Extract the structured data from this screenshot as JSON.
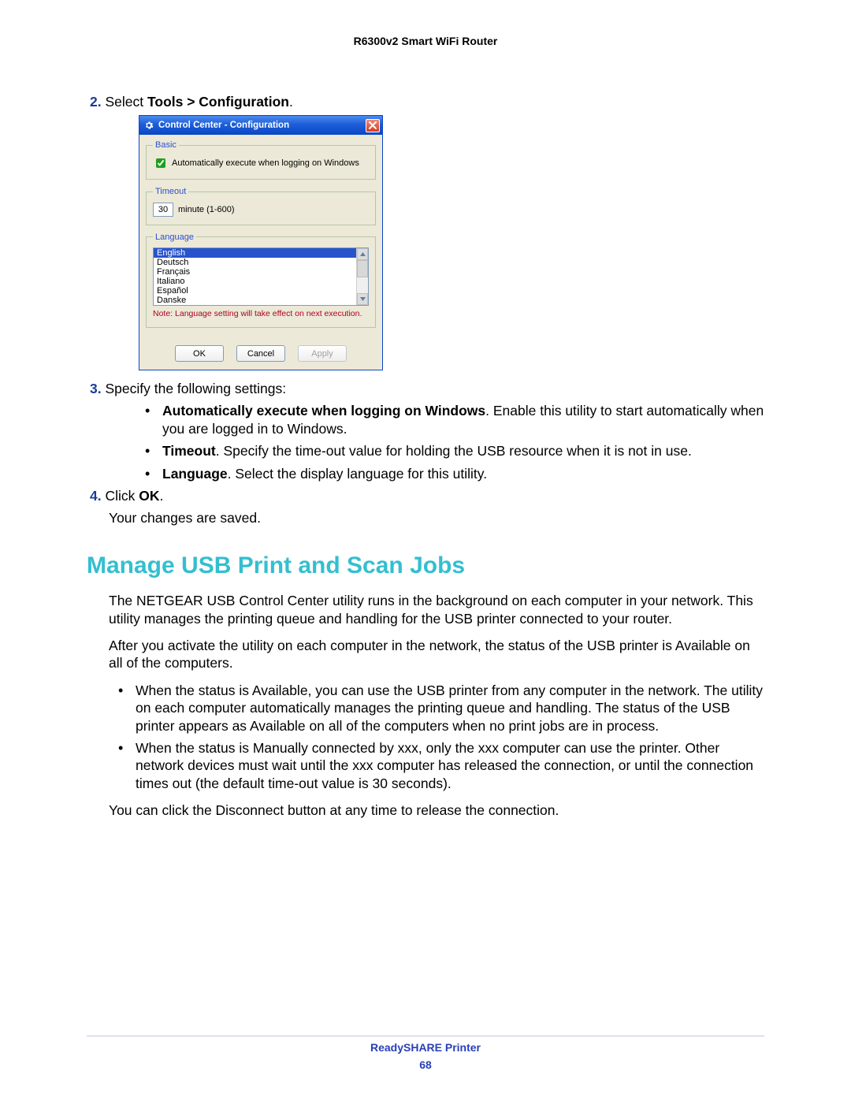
{
  "doc_header": "R6300v2 Smart WiFi Router",
  "steps": {
    "s2": {
      "num": "2.",
      "lead": "Select ",
      "bold": "Tools > Configuration",
      "trail": "."
    },
    "s3": {
      "num": "3.",
      "text": "Specify the following settings:"
    },
    "s4": {
      "num": "4.",
      "lead": "Click ",
      "bold": "OK",
      "trail": "."
    },
    "s4_sub": "Your changes are saved."
  },
  "settings_bullets": {
    "b1": {
      "bold": "Automatically execute when logging on Windows",
      "rest": ". Enable this utility to start automatically when you are logged in to Windows."
    },
    "b2": {
      "bold": "Timeout",
      "rest": ". Specify the time-out value for holding the USB resource when it is not in use."
    },
    "b3": {
      "bold": "Language",
      "rest": ". Select the display language for this utility."
    }
  },
  "section_heading": "Manage USB Print and Scan Jobs",
  "section_paras": {
    "p1": "The NETGEAR USB Control Center utility runs in the background on each computer in your network. This utility manages the printing queue and handling for the USB printer connected to your router.",
    "p2": "After you activate the utility on each computer in the network, the status of the USB printer is Available on all of the computers.",
    "p3": "You can click the Disconnect button at any time to release the connection."
  },
  "section_bullets": {
    "b1": "When the status is Available, you can use the USB printer from any computer in the network. The utility on each computer automatically manages the printing queue and handling. The status of the USB printer appears as Available on all of the computers when no print jobs are in process.",
    "b2": "When the status is Manually connected by xxx, only the xxx computer can use the printer. Other network devices must wait until the xxx computer has released the connection, or until the connection times out (the default time-out value is 30 seconds)."
  },
  "dialog": {
    "title": "Control Center - Configuration",
    "groups": {
      "basic": "Basic",
      "timeout": "Timeout",
      "language": "Language"
    },
    "checkbox_label": "Automatically execute when logging on Windows",
    "timeout_value": "30",
    "timeout_unit": "minute (1-600)",
    "languages": [
      "English",
      "Deutsch",
      "Français",
      "Italiano",
      "Español",
      "Danske"
    ],
    "lang_note": "Note: Language setting will take effect on next execution.",
    "buttons": {
      "ok": "OK",
      "cancel": "Cancel",
      "apply": "Apply"
    }
  },
  "footer": {
    "label": "ReadySHARE Printer",
    "page": "68"
  }
}
